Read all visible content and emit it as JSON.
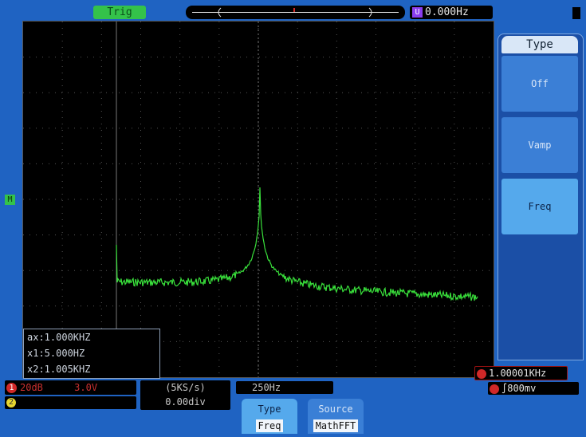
{
  "top_bar": {
    "trigger_status": "Trig",
    "frequency_counter": "0.000Hz",
    "frequency_badge": "U"
  },
  "menu": {
    "title": "Type",
    "items": [
      {
        "label": "Off",
        "selected": false
      },
      {
        "label": "Vamp",
        "selected": false
      },
      {
        "label": "Freq",
        "selected": true
      }
    ]
  },
  "cursor_box": {
    "lines": [
      "ax:1.000KHZ",
      "x1:5.000HZ",
      "x2:1.005KHZ"
    ]
  },
  "markers": {
    "math_marker": "M",
    "ch1_marker": "1",
    "ch2_marker": "2"
  },
  "status": {
    "ch1_scale": "20dB",
    "ch1_offset": "3.0V",
    "sample_rate": "(5KS/s)",
    "time_div": "0.00div",
    "frequency_resolution": "250Hz",
    "measured_frequency": "1.00001KHz",
    "trigger_level": "800mv"
  },
  "bottom_menu": {
    "type": {
      "label": "Type",
      "value": "Freq"
    },
    "source": {
      "label": "Source",
      "value": "MathFFT"
    }
  },
  "colors": {
    "background": "#1f63c2",
    "trace": "#39e03b",
    "screen": "#000000",
    "ch1": "#d12828",
    "ch2": "#e8d630"
  }
}
